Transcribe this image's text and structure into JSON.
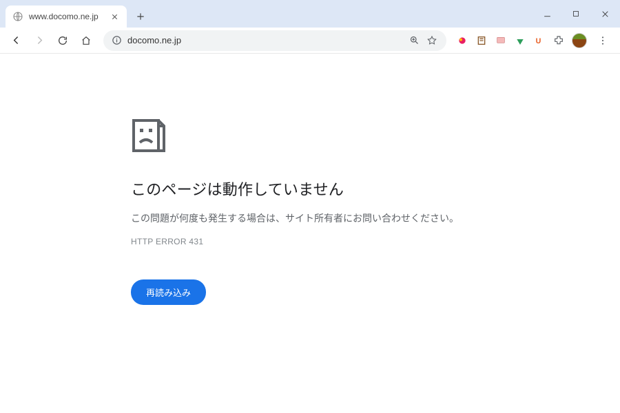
{
  "tab": {
    "title": "www.docomo.ne.jp"
  },
  "address_bar": {
    "url": "docomo.ne.jp"
  },
  "error_page": {
    "title": "このページは動作していません",
    "description": "この問題が何度も発生する場合は、サイト所有者にお問い合わせください。",
    "code": "HTTP ERROR 431",
    "reload_label": "再読み込み"
  }
}
